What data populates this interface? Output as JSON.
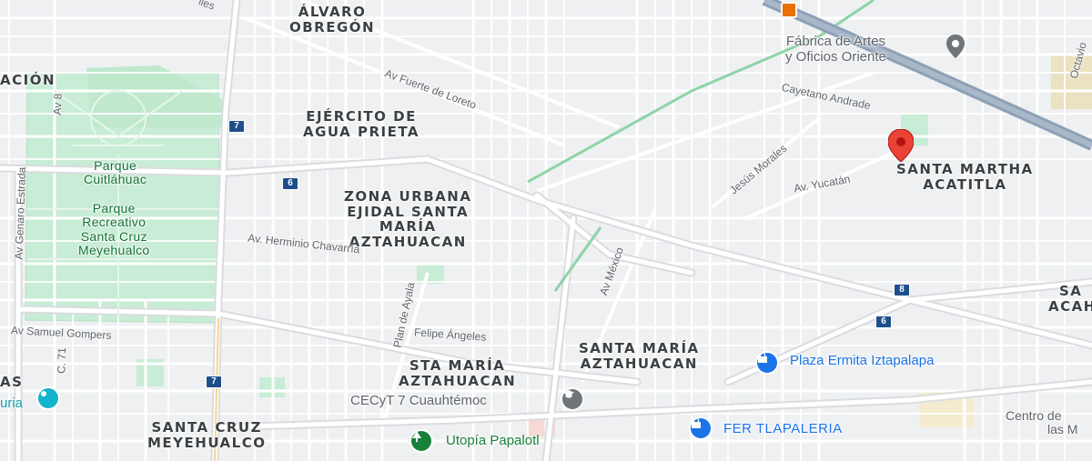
{
  "map": {
    "areas": [
      {
        "id": "alvaro",
        "lines": [
          "ÁLVARO",
          "OBREGÓN"
        ]
      },
      {
        "id": "acion",
        "lines": [
          "ACIÓN"
        ]
      },
      {
        "id": "ejercito",
        "lines": [
          "EJÉRCITO DE",
          "AGUA PRIETA"
        ]
      },
      {
        "id": "zona",
        "lines": [
          "ZONA URBANA",
          "EJIDAL SANTA",
          "MARÍA",
          "AZTAHUACAN"
        ]
      },
      {
        "id": "santa-martha",
        "lines": [
          "SANTA MARTHA",
          "ACATITLA"
        ]
      },
      {
        "id": "santa-maria",
        "lines": [
          "SANTA MARÍA",
          "AZTAHUACAN"
        ]
      },
      {
        "id": "sta-maria",
        "lines": [
          "STA MARÍA",
          "AZTAHUACAN"
        ]
      },
      {
        "id": "santa-cruz",
        "lines": [
          "SANTA CRUZ",
          "MEYEHUALCO"
        ]
      },
      {
        "id": "sa-acah",
        "lines": [
          "SA",
          "ACAH"
        ]
      },
      {
        "id": "as",
        "lines": [
          "AS"
        ]
      }
    ],
    "parks": {
      "cuitlahuac": [
        "Parque",
        "Cuitláhuac"
      ],
      "recreativo": [
        "Parque",
        "Recreativo",
        "Santa Cruz",
        "Meyehualco"
      ]
    },
    "streets": {
      "fuerte_loreto": "Av Fuerte de Loreto",
      "cayetano": "Cayetano Andrade",
      "jesus_morales": "Jesús Morales",
      "yucatan": "Av. Yucatán",
      "herminio": "Av. Herminio Chavarría",
      "plan_ayala": "Plan de Ayala",
      "av_mexico": "Av México",
      "felipe_angeles": "Felipe Ángeles",
      "samuel_gompers": "Av Samuel Gompers",
      "genaro_estrada": "Av Genaro Estrada",
      "av8": "Av 8",
      "c71": "C. 71",
      "octavio": "Octavio",
      "lles": "lles"
    },
    "shields": [
      "7",
      "6",
      "8",
      "6",
      "7"
    ],
    "pois": {
      "fabrica": [
        "Fábrica de Artes",
        "y Oficios Oriente"
      ],
      "plaza_ermita": "Plaza Ermita Iztapalapa",
      "cecyt": "CECyT 7 Cuauhtémoc",
      "fer": "FER TLAPALERIA",
      "utopia": "Utopía Papalotl",
      "centro": [
        "Centro de",
        "las M"
      ],
      "uria": "uria"
    },
    "colors": {
      "background": "#f1f3f4",
      "road": "#ffffff",
      "arterial": "#dadce0",
      "highway": "#8ea0b6",
      "park": "#c8ecd5",
      "pin": "#ea4335",
      "poi_blue": "#1a73e8",
      "poi_green": "#188038"
    }
  }
}
